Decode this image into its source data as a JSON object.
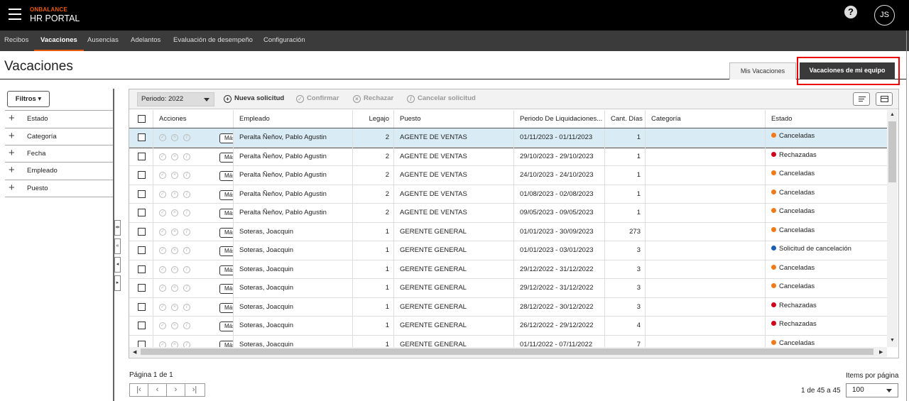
{
  "header": {
    "brand_top": "ONBALANCE",
    "brand_bottom": "HR PORTAL",
    "help": "?",
    "user_initials": "JS"
  },
  "nav": [
    {
      "label": "Recibos"
    },
    {
      "label": "Vacaciones",
      "active": true
    },
    {
      "label": "Ausencias"
    },
    {
      "label": "Adelantos"
    },
    {
      "label": "Evaluación de desempeño"
    },
    {
      "label": "Configuración"
    }
  ],
  "page": {
    "title": "Vacaciones",
    "tab_mine": "Mis Vacaciones",
    "tab_team": "Vacaciones de mi equipo"
  },
  "filters": {
    "button": "Filtros",
    "items": [
      "Estado",
      "Categoría",
      "Fecha",
      "Empleado",
      "Puesto"
    ]
  },
  "toolbar": {
    "period": "Periodo: 2022",
    "new_request": "Nueva solicitud",
    "confirm": "Confirmar",
    "reject": "Rechazar",
    "cancel_request": "Cancelar solicitud"
  },
  "table": {
    "columns": [
      "Acciones",
      "Empleado",
      "Legajo",
      "Puesto",
      "Periodo De Liquidaciones...",
      "Cant. Días",
      "Categoría",
      "Estado"
    ],
    "mas_label": "Más",
    "rows": [
      {
        "empleado": "Peralta Ñeñov, Pablo Agustin",
        "legajo": "2",
        "puesto": "AGENTE DE VENTAS",
        "periodo": "01/11/2023 - 01/11/2023",
        "dias": "1",
        "categoria": "",
        "estado": "Canceladas",
        "color": "#f07a1a"
      },
      {
        "empleado": "Peralta Ñeñov, Pablo Agustin",
        "legajo": "2",
        "puesto": "AGENTE DE VENTAS",
        "periodo": "29/10/2023 - 29/10/2023",
        "dias": "1",
        "categoria": "",
        "estado": "Rechazadas",
        "color": "#d0021b"
      },
      {
        "empleado": "Peralta Ñeñov, Pablo Agustin",
        "legajo": "2",
        "puesto": "AGENTE DE VENTAS",
        "periodo": "24/10/2023 - 24/10/2023",
        "dias": "1",
        "categoria": "",
        "estado": "Canceladas",
        "color": "#f07a1a"
      },
      {
        "empleado": "Peralta Ñeñov, Pablo Agustin",
        "legajo": "2",
        "puesto": "AGENTE DE VENTAS",
        "periodo": "01/08/2023 - 02/08/2023",
        "dias": "1",
        "categoria": "",
        "estado": "Canceladas",
        "color": "#f07a1a"
      },
      {
        "empleado": "Peralta Ñeñov, Pablo Agustin",
        "legajo": "2",
        "puesto": "AGENTE DE VENTAS",
        "periodo": "09/05/2023 - 09/05/2023",
        "dias": "1",
        "categoria": "",
        "estado": "Canceladas",
        "color": "#f07a1a"
      },
      {
        "empleado": "Soteras, Joacquin",
        "legajo": "1",
        "puesto": "GERENTE GENERAL",
        "periodo": "01/01/2023 - 30/09/2023",
        "dias": "273",
        "categoria": "",
        "estado": "Canceladas",
        "color": "#f07a1a"
      },
      {
        "empleado": "Soteras, Joacquin",
        "legajo": "1",
        "puesto": "GERENTE GENERAL",
        "periodo": "01/01/2023 - 03/01/2023",
        "dias": "3",
        "categoria": "",
        "estado": "Solicitud de cancelación",
        "color": "#1a5fb4"
      },
      {
        "empleado": "Soteras, Joacquin",
        "legajo": "1",
        "puesto": "GERENTE GENERAL",
        "periodo": "29/12/2022 - 31/12/2022",
        "dias": "3",
        "categoria": "",
        "estado": "Canceladas",
        "color": "#f07a1a"
      },
      {
        "empleado": "Soteras, Joacquin",
        "legajo": "1",
        "puesto": "GERENTE GENERAL",
        "periodo": "29/12/2022 - 31/12/2022",
        "dias": "3",
        "categoria": "",
        "estado": "Canceladas",
        "color": "#f07a1a"
      },
      {
        "empleado": "Soteras, Joacquin",
        "legajo": "1",
        "puesto": "GERENTE GENERAL",
        "periodo": "28/12/2022 - 30/12/2022",
        "dias": "3",
        "categoria": "",
        "estado": "Rechazadas",
        "color": "#d0021b"
      },
      {
        "empleado": "Soteras, Joacquin",
        "legajo": "1",
        "puesto": "GERENTE GENERAL",
        "periodo": "26/12/2022 - 29/12/2022",
        "dias": "4",
        "categoria": "",
        "estado": "Rechazadas",
        "color": "#d0021b"
      },
      {
        "empleado": "Soteras, Joacquin",
        "legajo": "1",
        "puesto": "GERENTE GENERAL",
        "periodo": "01/11/2022 - 07/11/2022",
        "dias": "7",
        "categoria": "",
        "estado": "Canceladas",
        "color": "#f07a1a"
      }
    ]
  },
  "pager": {
    "page_text": "Página 1 de 1",
    "items_per_page_label": "Items por página",
    "range_text": "1 de 45 a 45",
    "items_per_page": "100"
  }
}
